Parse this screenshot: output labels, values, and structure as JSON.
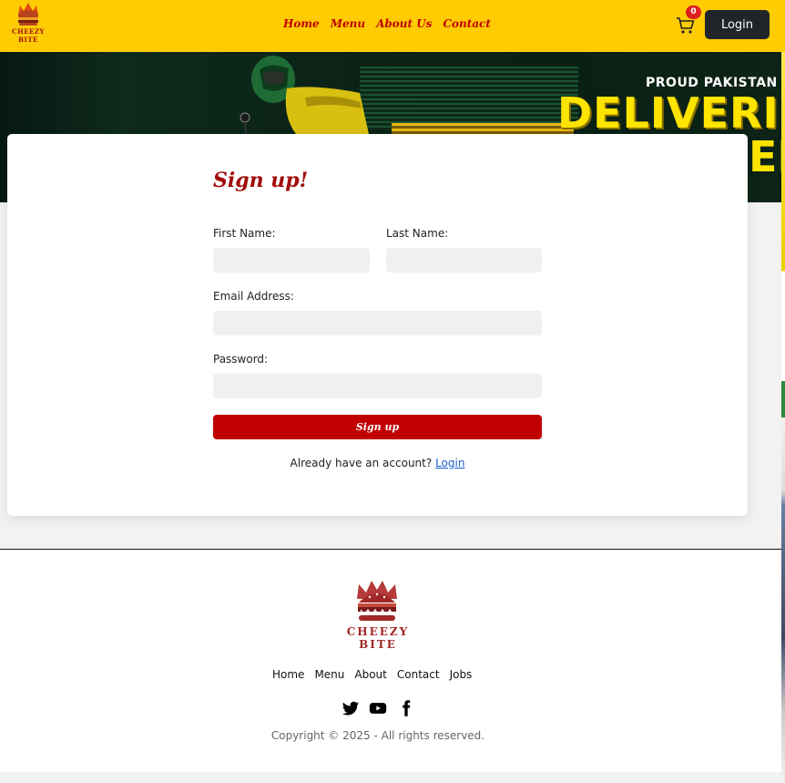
{
  "brand": {
    "name": "CHEEZY BITE",
    "primary_color": "#ffcc03",
    "accent_color": "#c00000"
  },
  "navbar": {
    "links": [
      {
        "label": "Home"
      },
      {
        "label": "Menu"
      },
      {
        "label": "About Us"
      },
      {
        "label": "Contact"
      }
    ],
    "cart_count": "0",
    "cart_icon": "shopping-cart-icon",
    "login_label": "Login"
  },
  "hero": {
    "subtitle": "PROUD PAKISTAN",
    "headline": "DELIVERI",
    "headline_line2": "EE"
  },
  "signup": {
    "title": "Sign up!",
    "first_name_label": "First Name:",
    "last_name_label": "Last Name:",
    "email_label": "Email Address:",
    "password_label": "Password:",
    "first_name_value": "",
    "last_name_value": "",
    "email_value": "",
    "password_value": "",
    "submit_label": "Sign up",
    "already_text": "Already have an account?",
    "login_link": "Login"
  },
  "footer": {
    "logo_text": "CHEEZY BITE",
    "links": [
      {
        "label": "Home"
      },
      {
        "label": "Menu"
      },
      {
        "label": "About"
      },
      {
        "label": "Contact"
      },
      {
        "label": "Jobs"
      }
    ],
    "social_icons": [
      "twitter-icon",
      "youtube-icon",
      "facebook-icon"
    ],
    "copyright": "Copyright © 2025 - All rights reserved."
  }
}
